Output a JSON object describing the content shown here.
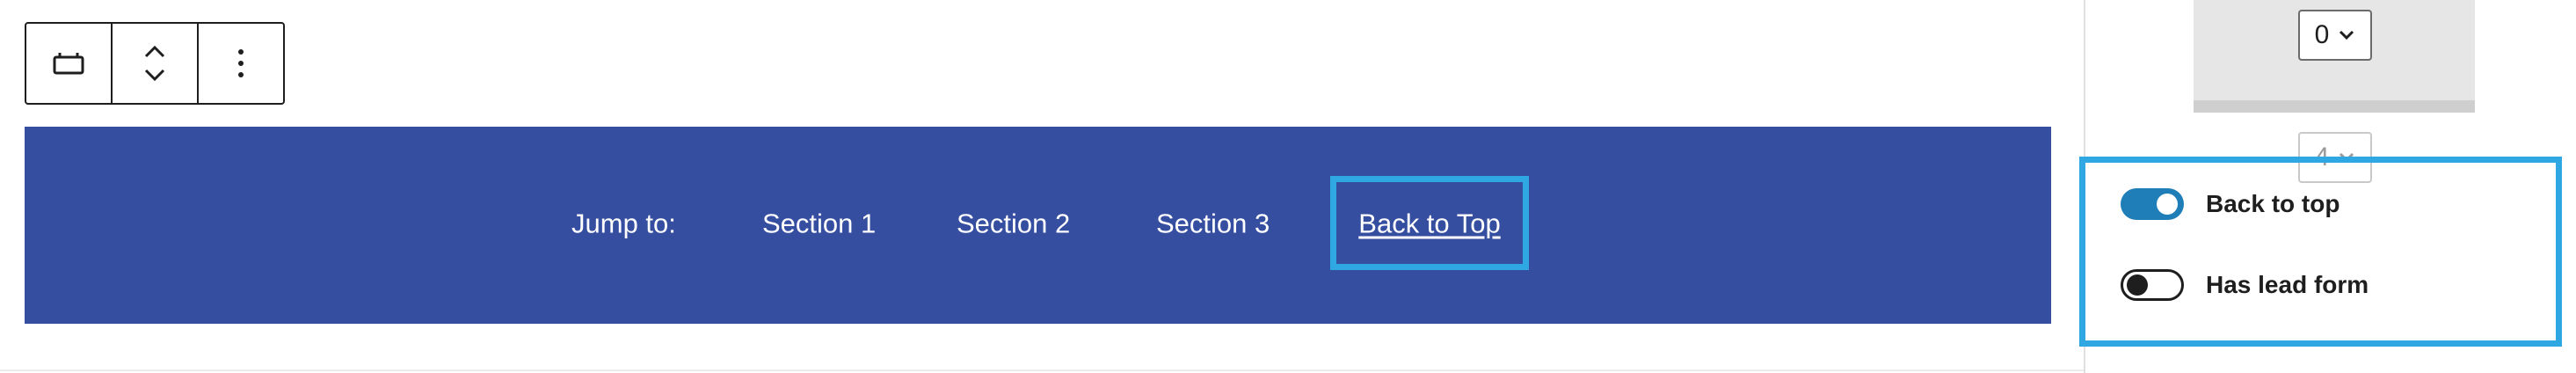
{
  "toolbar": {
    "icons": [
      "block-type-icon",
      "move-up-down-icon",
      "more-options-icon"
    ]
  },
  "nav": {
    "jump_label": "Jump to:",
    "links": [
      "Section 1",
      "Section 2",
      "Section 3"
    ],
    "back_to_top": "Back to Top"
  },
  "sidebar": {
    "select_top_value": "0",
    "select_bottom_value": "4",
    "toggles": [
      {
        "label": "Back to top",
        "checked": true
      },
      {
        "label": "Has lead form",
        "checked": false
      }
    ]
  },
  "colors": {
    "nav_background": "#354ea0",
    "highlight": "#2ea7e3",
    "toggle_on": "#1f7eb7"
  }
}
